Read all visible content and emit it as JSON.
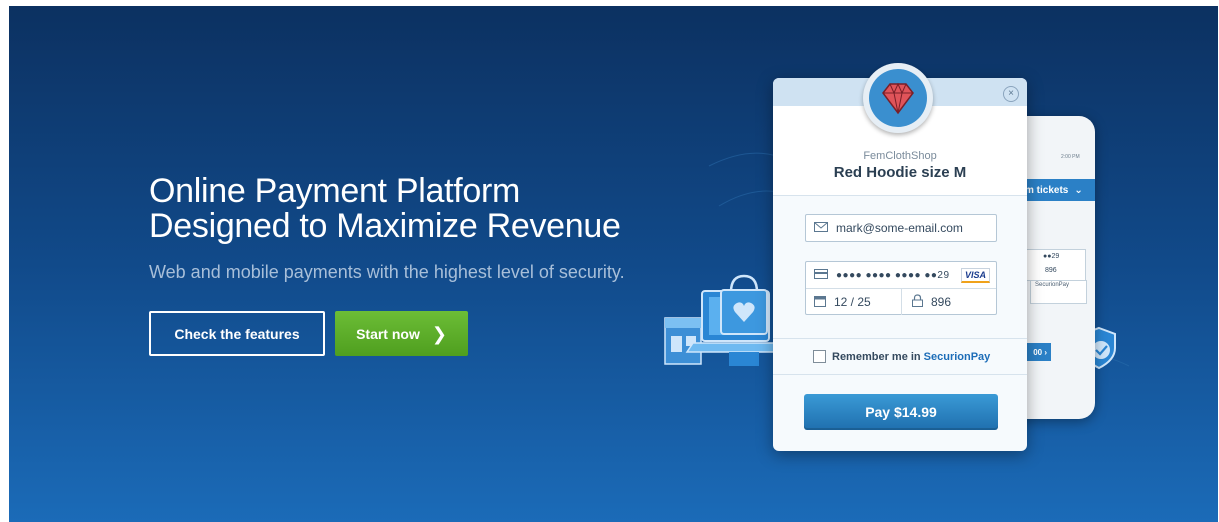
{
  "hero": {
    "title_line1": "Online Payment Platform",
    "title_line2": "Designed to Maximize Revenue",
    "subtitle": "Web and mobile payments with the highest level of security.",
    "btn_features": "Check the features",
    "btn_start": "Start now",
    "btn_start_chevron": "❯"
  },
  "checkout": {
    "close": "×",
    "shop": "FemClothShop",
    "product": "Red Hoodie size M",
    "email": "mark@some-email.com",
    "card_number": "●●●● ●●●● ●●●● ●●29",
    "card_brand": "VISA",
    "expiry": "12 / 25",
    "cvc": "896",
    "remember_prefix": "Remember me in",
    "remember_brand": "SecurionPay",
    "pay_button": "Pay $14.99"
  },
  "phone": {
    "time": "2:00 PM",
    "tickets": "m tickets",
    "card_tail": "●●29",
    "cvc": "896",
    "brand": "SecurionPay",
    "pay_partial": "00 ›"
  },
  "colors": {
    "accent_green": "#5aaa2a",
    "accent_blue": "#2b80c6",
    "gem_red": "#e0545a"
  }
}
